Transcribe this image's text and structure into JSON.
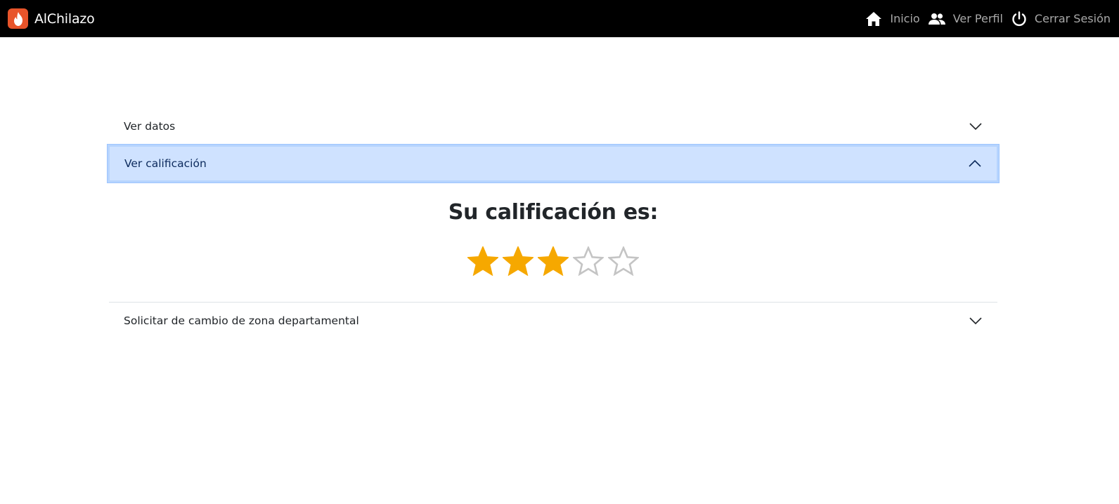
{
  "navbar": {
    "brand_name": "AlChilazo",
    "links": [
      {
        "label": "Inicio",
        "icon": "home-icon"
      },
      {
        "label": "Ver Perfil",
        "icon": "users-icon"
      },
      {
        "label": "Cerrar Sesión",
        "icon": "power-icon"
      }
    ]
  },
  "accordion": {
    "items": [
      {
        "label": "Ver datos",
        "expanded": false
      },
      {
        "label": "Ver calificación",
        "expanded": true
      },
      {
        "label": "Solicitar de cambio de zona departamental",
        "expanded": false
      }
    ]
  },
  "rating": {
    "title": "Su calificación es:",
    "value": 3,
    "max": 5
  },
  "colors": {
    "navbar_bg": "#000000",
    "brand_accent": "#e8542a",
    "nav_link": "#a9a9a9",
    "active_header_bg": "#cfe2ff",
    "star_filled": "#f6a800",
    "star_empty": "#c4c4c4"
  }
}
